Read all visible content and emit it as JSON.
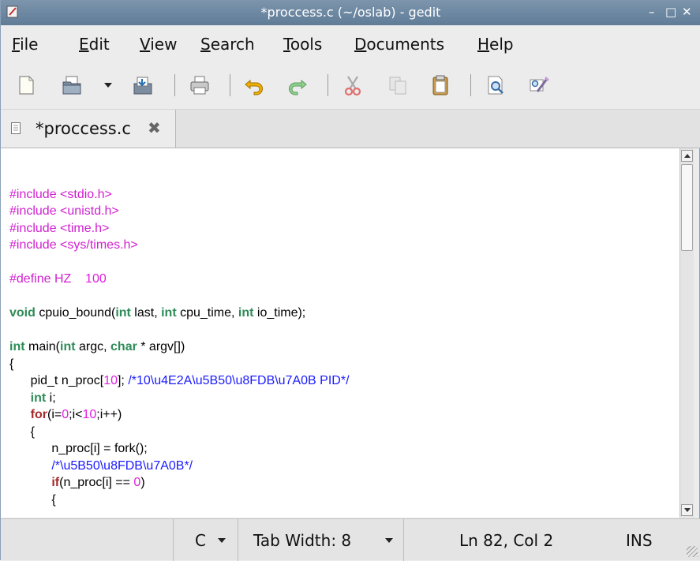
{
  "window": {
    "title": "*proccess.c (~/oslab) - gedit",
    "controls": {
      "minimize": "–",
      "maximize": "□",
      "close": "✕"
    }
  },
  "menubar": {
    "items": [
      {
        "label": "File",
        "mnemonic": "F",
        "rest": "ile"
      },
      {
        "label": "Edit",
        "mnemonic": "E",
        "rest": "dit"
      },
      {
        "label": "View",
        "mnemonic": "V",
        "rest": "iew"
      },
      {
        "label": "Search",
        "mnemonic": "S",
        "rest": "earch"
      },
      {
        "label": "Tools",
        "mnemonic": "T",
        "rest": "ools"
      },
      {
        "label": "Documents",
        "mnemonic": "D",
        "rest": "ocuments"
      },
      {
        "label": "Help",
        "mnemonic": "H",
        "rest": "elp"
      }
    ]
  },
  "toolbar": {
    "icons": [
      "new-document-icon",
      "open-icon",
      "open-dropdown-icon",
      "save-icon",
      "print-icon",
      "undo-icon",
      "redo-icon",
      "cut-icon",
      "copy-icon",
      "paste-icon",
      "find-icon",
      "find-replace-icon"
    ]
  },
  "tab": {
    "label": "*proccess.c",
    "close": "✖"
  },
  "editor": {
    "lines": [
      "",
      "#include <stdio.h>",
      "#include <unistd.h>",
      "#include <time.h>",
      "#include <sys/times.h>",
      "",
      "#define HZ    100",
      "",
      "void cpuio_bound(int last, int cpu_time, int io_time);",
      "",
      "int main(int argc, char * argv[])",
      "{",
      "      pid_t n_proc[10]; /*10\\u4E2A\\u5B50\\u8FDB\\u7A0B PID*/",
      "      int i;",
      "      for(i=0;i<10;i++)",
      "      {",
      "            n_proc[i] = fork();",
      "            /*\\u5B50\\u8FDB\\u7A0B*/",
      "            if(n_proc[i] == 0)",
      "            {"
    ],
    "colors": {
      "preprocessor": "#d020d0",
      "keyword": "#2e8b57",
      "control": "#a52a2a",
      "number": "#e020e0",
      "comment": "#1a1aff"
    }
  },
  "statusbar": {
    "language": "C",
    "tab_width": "Tab Width:  8",
    "position": "Ln 82, Col 2",
    "mode": "INS"
  }
}
